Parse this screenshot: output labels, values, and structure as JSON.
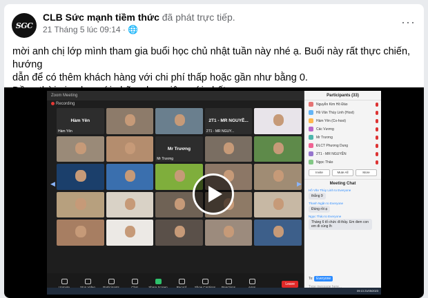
{
  "post": {
    "author": "CLB Sức mạnh tiềm thức",
    "action": "đã phát trực tiếp.",
    "time": "21 Tháng 5 lúc 09:14",
    "globe": "🌐",
    "avatar_text": "SGC",
    "more": "···",
    "text_lines": [
      "mời anh chị lớp mình tham gia buổi học chủ nhật tuần này nhé ạ. Buổi này rất thực chiến, hướng",
      "dẫn để có thêm khách hàng với chi phí thấp hoặc gần như bằng 0.",
      "Đồng thời giao lưu với những học viên mới nhất ạ."
    ]
  },
  "zoom": {
    "title": "Zoom Meeting",
    "recording": "Recording",
    "tiles": [
      {
        "label": "Hàm Yên",
        "center": "Hàm Yên",
        "color": "#2d2d2d"
      },
      {
        "label": "",
        "center": "",
        "color": "#8d7b6a"
      },
      {
        "label": "",
        "center": "",
        "color": "#6a7f8e"
      },
      {
        "label": "2T1 - MR NGUY...",
        "center": "2T1 - MR NGUYỄ...",
        "color": "#2d2d2d"
      },
      {
        "label": "",
        "center": "",
        "color": "#e8e4ea"
      },
      {
        "label": "",
        "center": "",
        "color": "#9a8a78"
      },
      {
        "label": "",
        "center": "",
        "color": "#b48d6e"
      },
      {
        "label": "Mr Trương",
        "center": "Mr Trương",
        "color": "#2d2d2d"
      },
      {
        "label": "",
        "center": "",
        "color": "#7a6e62"
      },
      {
        "label": "",
        "center": "",
        "color": "#5e8a4a"
      },
      {
        "label": "",
        "center": "",
        "color": "#1b3f6b"
      },
      {
        "label": "",
        "center": "",
        "color": "#3a6fae"
      },
      {
        "label": "",
        "center": "",
        "color": "#7fae3c"
      },
      {
        "label": "",
        "center": "",
        "color": "#8c7766"
      },
      {
        "label": "",
        "center": "",
        "color": "#a08c74"
      },
      {
        "label": "",
        "center": "",
        "color": "#b7a07e"
      },
      {
        "label": "",
        "center": "",
        "color": "#d9d2c6"
      },
      {
        "label": "",
        "center": "",
        "color": "#6f6255"
      },
      {
        "label": "",
        "center": "",
        "color": "#8e7a66"
      },
      {
        "label": "",
        "center": "",
        "color": "#c7b8a4"
      },
      {
        "label": "",
        "center": "",
        "color": "#a77e62"
      },
      {
        "label": "",
        "center": "",
        "color": "#ece9e5"
      },
      {
        "label": "",
        "center": "",
        "color": "#5a5049"
      },
      {
        "label": "",
        "center": "",
        "color": "#9c8b7d"
      },
      {
        "label": "",
        "center": "",
        "color": "#3d5f8a"
      }
    ],
    "participants_title": "Participants (33)",
    "participants": [
      {
        "name": "Nguyễn Kim Hồ Đào",
        "color": "#e57373"
      },
      {
        "name": "Hồ Văn Thùy Linh (Host)",
        "color": "#64b5f6"
      },
      {
        "name": "Hàm Yên (Co-host)",
        "color": "#ffb74d"
      },
      {
        "name": "Các Vương",
        "color": "#ba68c8"
      },
      {
        "name": "Mr Trương",
        "color": "#4db6ac"
      },
      {
        "name": "ĐLCT Phương Dung",
        "color": "#f06292"
      },
      {
        "name": "2T1 - MR NGUYỄN",
        "color": "#9575cd"
      },
      {
        "name": "Ngọc Thảo",
        "color": "#81c784"
      }
    ],
    "panel_buttons": [
      "Invite",
      "Mute All",
      "More"
    ],
    "chat_title": "Meeting Chat",
    "messages": [
      {
        "who": "Hồ Văn Thùy Linh to Everyone",
        "text": "thắng 9"
      },
      {
        "who": "Thanh Ngân to Everyone",
        "text": "Đúng rồi ạ"
      },
      {
        "who": "Ngọc Thảo to Everyone",
        "text": "Tháng 6 tổ chức đi thầy. Em đem con em đi cùng lh"
      }
    ],
    "to_label": "Everyone",
    "type_placeholder": "Type message here...",
    "toolbar": [
      "Unmute",
      "Stop Video",
      "Participants",
      "Chat",
      "Share Screen",
      "Record",
      "Show Captions",
      "Reactions",
      "Apps"
    ],
    "end_label": "Leave",
    "clock": "09:13  21/05/2023"
  }
}
